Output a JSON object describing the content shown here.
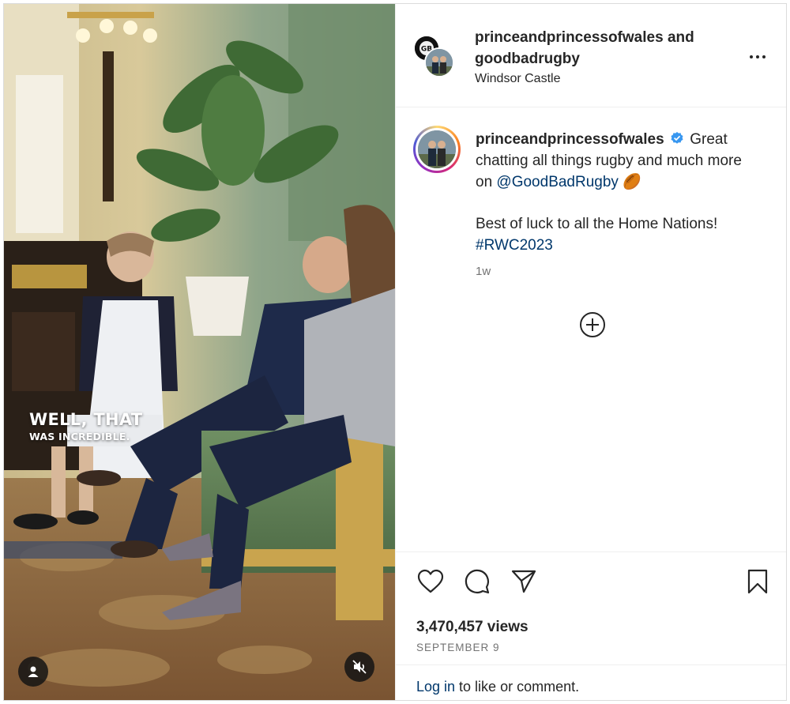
{
  "media": {
    "caption_line1": "WELL, THAT",
    "caption_line2": "WAS INCREDIBLE.",
    "user_tag_icon": "user-icon",
    "mute_icon": "speaker-muted-icon"
  },
  "header": {
    "author1": "princeandprincessofwales",
    "connector": "and",
    "author2": "goodbadrugby",
    "location": "Windsor Castle",
    "more_icon": "more-horizontal-icon",
    "avatar1_text": "GB"
  },
  "post": {
    "author": "princeandprincessofwales",
    "verified_icon": "verified-badge-icon",
    "text_part1": "Great chatting all things rugby and much more on",
    "mention": "@GoodBadRugby",
    "emoji": "🏉",
    "text_part2": "Best of luck to all the Home Nations!",
    "hashtag": "#RWC2023",
    "time": "1w",
    "load_more_icon": "plus-circle-icon"
  },
  "actions": {
    "like_icon": "heart-icon",
    "comment_icon": "comment-icon",
    "share_icon": "send-icon",
    "save_icon": "bookmark-icon",
    "views": "3,470,457 views",
    "date": "September 9",
    "login_link": "Log in",
    "login_rest": " to like or comment."
  },
  "colors": {
    "link": "#00376b",
    "verified": "#3897f0",
    "muted_text": "#737373",
    "border": "#efefef"
  }
}
